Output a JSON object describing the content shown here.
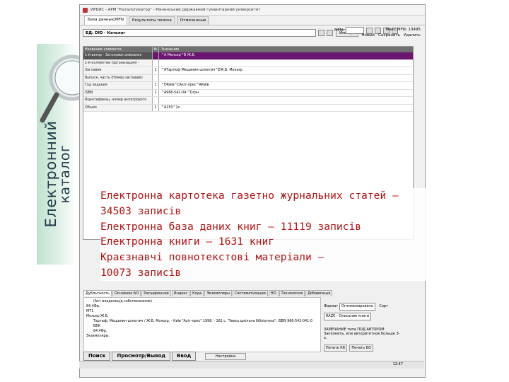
{
  "slide": {
    "vertical_title_line1": "Електронний",
    "vertical_title_line2": "каталог"
  },
  "window": {
    "title": "ИРБИС - АРМ \"Каталогизатор\" - Рівненський державний гуманітарний університет",
    "tabs": [
      "База данных/MFN",
      "Результаты поиска",
      "Отмеченные"
    ],
    "db_label": "БД: DID - Каталог",
    "import_button": "Импорт",
    "mfn_label": "MFN:",
    "max_mfn": "Макс.MFN: 13495",
    "actions": [
      "Новый",
      "Сохранить",
      "Удалить"
    ]
  },
  "grid": {
    "headers": [
      "Название элемента",
      "№",
      "Значение"
    ],
    "rows": [
      {
        "name": "1-й автор - Заголовок описания",
        "no": "",
        "value": "^A Мельер^B Ж.Б.",
        "selected": true
      },
      {
        "name": "1-й коллектив (организация) - заголовок описан.",
        "no": "",
        "value": ""
      },
      {
        "name": "Заглавие",
        "no": "1",
        "value": "^AТартюф Мещанин-шляхтич^EЖ.Б. Мольєр"
      },
      {
        "name": "Выпуск, часть (Номер-заглавие)",
        "no": "",
        "value": ""
      },
      {
        "name": "Год издания",
        "no": "1",
        "value": "^DКиїв^CАхіт-прес^AКиїв"
      },
      {
        "name": "ISBN",
        "no": "1",
        "value": "^A966-542-04-^Dгрн."
      },
      {
        "name": "Идентификац. номер интегрового материала",
        "no": "",
        "value": ""
      },
      {
        "name": "Объем",
        "no": "1",
        "value": "^A150^1с."
      }
    ]
  },
  "overlay": {
    "lines": [
      "Електронна картотека газетно журнальних статей –",
      "34503 записів",
      "Електронна база даних книг – 11119 записів",
      "Електронна книги – 1631 книг",
      "Краєзнавчі повнотекстові матеріали –",
      "10073 записів"
    ]
  },
  "bottom": {
    "tabs": [
      "Дубльтность",
      "Основное БО",
      "Расширенное",
      "Индекс",
      "Кода",
      "Экземпляры",
      "Систематизация",
      "НО",
      "Технология",
      "Добавочные"
    ],
    "card_lines": [
      "(Акт владелец/д собственников)",
      "84.4Фр.",
      "М71",
      "Мольєр Ж.Б.",
      "Тартюф. Мещанин-шляхтич / Ж.Б. Мольєр. - Київ \"Ахіт-прес\" 1998. - 162 с. \"Увесь шкільна бібліотека\". ISBN 966-542-041-0",
      "ББК",
      "84.4Фр.",
      "Экземпляры:"
    ],
    "format_label": "Формат",
    "format_value": "Оптимизировано",
    "sort_label": "Сорт",
    "sort_value": "RAZK - Описание книги",
    "note": "ЗАМЕЧАНИЕ типа ПОД АВТОРОМ Заполнить, или авторитетное больше 3-х.",
    "small_buttons": [
      "Печать КК",
      "Печать БО"
    ],
    "main_buttons": [
      "Поиск",
      "Просмотр/Вывод",
      "Ввод"
    ],
    "settings_button": "Настройка",
    "status_time": "12:47"
  }
}
